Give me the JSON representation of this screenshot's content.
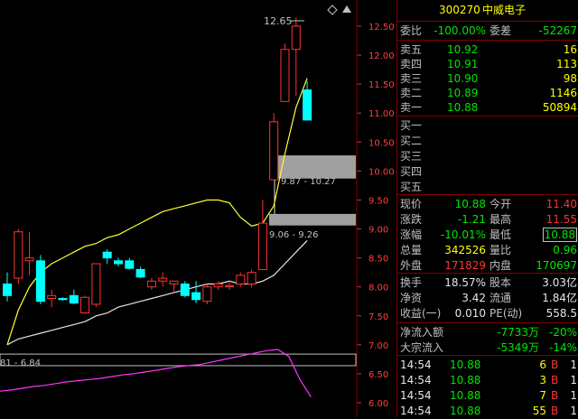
{
  "stock": {
    "code": "300270",
    "name": "中威电子"
  },
  "header": [
    {
      "l1": "委比",
      "v1": "-100.00%",
      "l2": "委差",
      "v2": "-52267"
    }
  ],
  "asks": [
    {
      "label": "卖五",
      "price": "10.92",
      "vol": "16"
    },
    {
      "label": "卖四",
      "price": "10.91",
      "vol": "113"
    },
    {
      "label": "卖三",
      "price": "10.90",
      "vol": "98"
    },
    {
      "label": "卖二",
      "price": "10.89",
      "vol": "1146"
    },
    {
      "label": "卖一",
      "price": "10.88",
      "vol": "50894"
    }
  ],
  "bids": [
    {
      "label": "买一"
    },
    {
      "label": "买二"
    },
    {
      "label": "买三"
    },
    {
      "label": "买四"
    },
    {
      "label": "买五"
    }
  ],
  "quote": [
    {
      "l1": "现价",
      "v1": "10.88",
      "c1": "grn",
      "l2": "今开",
      "v2": "11.40",
      "c2": "red"
    },
    {
      "l1": "涨跌",
      "v1": "-1.21",
      "c1": "grn",
      "l2": "最高",
      "v2": "11.55",
      "c2": "red"
    },
    {
      "l1": "涨幅",
      "v1": "-10.01%",
      "c1": "grn",
      "l2": "最低",
      "v2": "10.88",
      "c2": "grn"
    },
    {
      "l1": "总量",
      "v1": "342526",
      "c1": "yel",
      "l2": "量比",
      "v2": "0.96",
      "c2": "grn"
    },
    {
      "l1": "外盘",
      "v1": "171829",
      "c1": "red",
      "l2": "内盘",
      "v2": "170697",
      "c2": "grn"
    }
  ],
  "stats": [
    {
      "l1": "换手",
      "v1": "18.57%",
      "l2": "股本",
      "v2": "3.03亿"
    },
    {
      "l1": "净资",
      "v1": "3.42",
      "l2": "流通",
      "v2": "1.84亿"
    },
    {
      "l1": "收益(一)",
      "v1": "0.010",
      "l2": "PE(动)",
      "v2": "558.5"
    }
  ],
  "flows": [
    {
      "label": "净流入额",
      "value": "-7733万",
      "pct": "-20%"
    },
    {
      "label": "大宗流入",
      "value": "-5349万",
      "pct": "-14%"
    }
  ],
  "trades": [
    {
      "time": "14:54",
      "price": "10.88",
      "vol": "6",
      "bs": "B",
      "n": "1"
    },
    {
      "time": "14:54",
      "price": "10.88",
      "vol": "3",
      "bs": "B",
      "n": "1"
    },
    {
      "time": "14:54",
      "price": "10.88",
      "vol": "7",
      "bs": "B",
      "n": "1"
    },
    {
      "time": "14:54",
      "price": "10.88",
      "vol": "55",
      "bs": "B",
      "n": "1"
    }
  ],
  "chart_data": {
    "type": "candlestick",
    "y_ticks": [
      "12.50",
      "12.00",
      "11.50",
      "11.00",
      "10.50",
      "10.00",
      "9.50",
      "9.00",
      "8.50",
      "8.00",
      "7.50",
      "7.00",
      "6.50",
      "6.00"
    ],
    "ylim": [
      5.95,
      12.75
    ],
    "high_label": "12.65",
    "zone_upper": {
      "text": "9.87 - 10.27",
      "low": 9.87,
      "high": 10.27
    },
    "zone_lower": {
      "text": "9.06 - 9.26",
      "low": 9.06,
      "high": 9.26
    },
    "zone_bottom": {
      "text": "81 - 6.84",
      "low": 6.64,
      "high": 6.84
    },
    "candles": [
      {
        "o": 8.05,
        "h": 8.25,
        "l": 7.75,
        "c": 7.85
      },
      {
        "o": 8.15,
        "h": 9.0,
        "l": 8.05,
        "c": 8.95
      },
      {
        "o": 8.45,
        "h": 8.95,
        "l": 8.2,
        "c": 8.5
      },
      {
        "o": 8.45,
        "h": 8.55,
        "l": 7.7,
        "c": 7.75
      },
      {
        "o": 7.8,
        "h": 7.95,
        "l": 7.65,
        "c": 7.85
      },
      {
        "o": 7.8,
        "h": 7.82,
        "l": 7.76,
        "c": 7.78
      },
      {
        "o": 7.85,
        "h": 7.95,
        "l": 7.7,
        "c": 7.72
      },
      {
        "o": 7.55,
        "h": 7.85,
        "l": 7.55,
        "c": 7.82
      },
      {
        "o": 7.7,
        "h": 8.4,
        "l": 7.65,
        "c": 8.4
      },
      {
        "o": 8.6,
        "h": 8.65,
        "l": 8.4,
        "c": 8.5
      },
      {
        "o": 8.45,
        "h": 8.5,
        "l": 8.35,
        "c": 8.4
      },
      {
        "o": 8.45,
        "h": 8.5,
        "l": 8.3,
        "c": 8.32
      },
      {
        "o": 8.3,
        "h": 8.35,
        "l": 8.15,
        "c": 8.17
      },
      {
        "o": 8.0,
        "h": 8.15,
        "l": 7.95,
        "c": 8.1
      },
      {
        "o": 8.1,
        "h": 8.25,
        "l": 8.0,
        "c": 8.15
      },
      {
        "o": 8.05,
        "h": 8.1,
        "l": 7.9,
        "c": 8.1
      },
      {
        "o": 8.05,
        "h": 8.1,
        "l": 7.82,
        "c": 7.85
      },
      {
        "o": 7.9,
        "h": 8.1,
        "l": 7.72,
        "c": 7.78
      },
      {
        "o": 7.75,
        "h": 8.05,
        "l": 7.7,
        "c": 8.0
      },
      {
        "o": 8.0,
        "h": 8.1,
        "l": 7.95,
        "c": 8.05
      },
      {
        "o": 8.0,
        "h": 8.1,
        "l": 7.95,
        "c": 8.02
      },
      {
        "o": 8.05,
        "h": 8.25,
        "l": 8.0,
        "c": 8.2
      },
      {
        "o": 8.05,
        "h": 8.3,
        "l": 8.0,
        "c": 8.25
      },
      {
        "o": 8.3,
        "h": 9.5,
        "l": 8.3,
        "c": 9.1
      },
      {
        "o": 9.85,
        "h": 11.0,
        "l": 9.85,
        "c": 10.85
      },
      {
        "o": 11.2,
        "h": 12.2,
        "l": 11.2,
        "c": 12.1
      },
      {
        "o": 12.1,
        "h": 12.65,
        "l": 11.3,
        "c": 12.5
      },
      {
        "o": 11.4,
        "h": 11.55,
        "l": 10.88,
        "c": 10.88
      }
    ],
    "upper_band": [
      7.0,
      7.6,
      8.0,
      8.25,
      8.4,
      8.5,
      8.6,
      8.7,
      8.75,
      8.85,
      8.9,
      9.0,
      9.1,
      9.2,
      9.3,
      9.35,
      9.4,
      9.45,
      9.5,
      9.5,
      9.45,
      9.2,
      9.05,
      9.1,
      9.4,
      10.3,
      11.1,
      11.6
    ],
    "lower_band": [
      7.0,
      7.1,
      7.15,
      7.2,
      7.25,
      7.3,
      7.35,
      7.4,
      7.5,
      7.55,
      7.65,
      7.7,
      7.75,
      7.8,
      7.85,
      7.9,
      7.95,
      8.0,
      8.05,
      8.05,
      8.1,
      8.05,
      8.05,
      8.1,
      8.2,
      8.4,
      8.6,
      8.8
    ],
    "indicator": [
      6.2,
      6.22,
      6.25,
      6.28,
      6.3,
      6.33,
      6.36,
      6.38,
      6.4,
      6.42,
      6.45,
      6.48,
      6.5,
      6.53,
      6.56,
      6.59,
      6.62,
      6.64,
      6.66,
      6.7,
      6.74,
      6.78,
      6.82,
      6.86,
      6.9,
      6.92,
      6.8,
      6.4,
      6.1
    ]
  }
}
